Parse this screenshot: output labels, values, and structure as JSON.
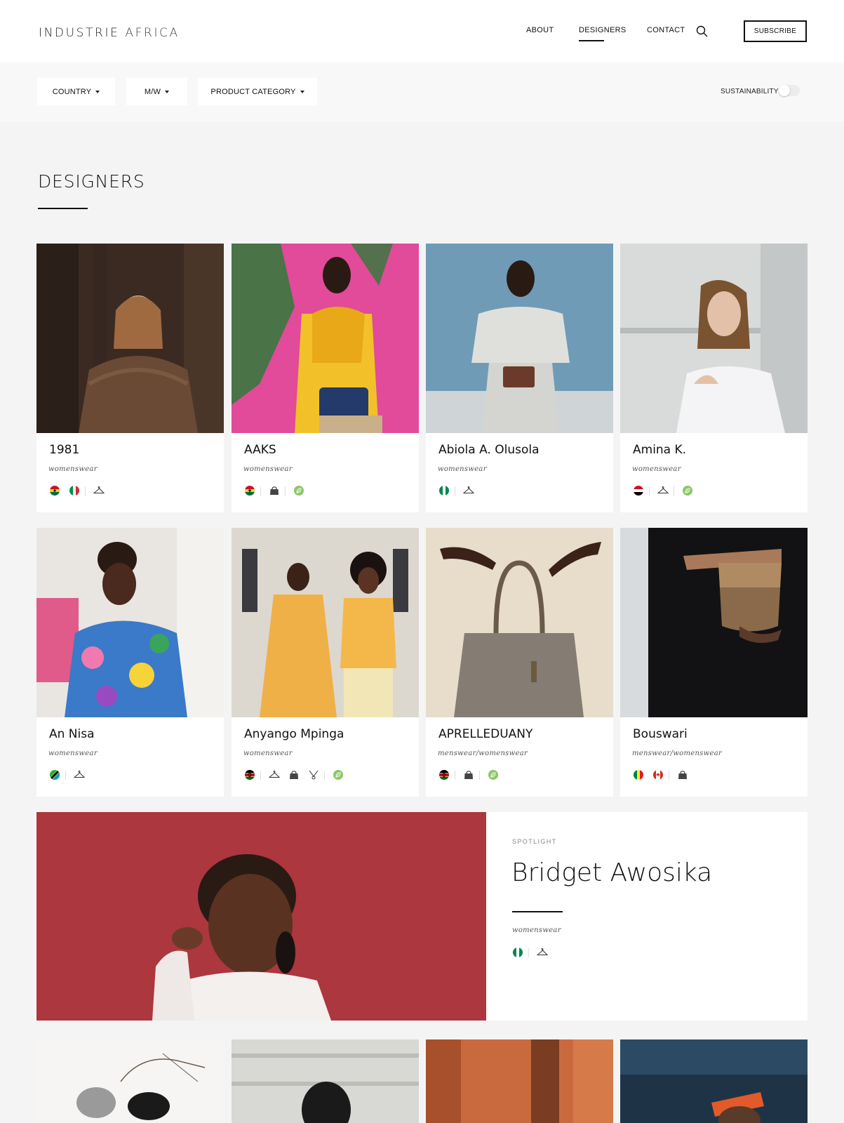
{
  "header": {
    "logo_part1": "INDUSTRIE",
    "logo_part2": "AFRICA",
    "nav": [
      {
        "label": "ABOUT"
      },
      {
        "label": "DESIGNERS",
        "active": true
      },
      {
        "label": "CONTACT"
      }
    ],
    "subscribe_label": "SUBSCRIBE"
  },
  "filters": {
    "country": "COUNTRY",
    "mw": "M/W",
    "product_category": "PRODUCT CATEGORY",
    "sustainability_label": "SUSTAINABILITY",
    "sustainability_on": false
  },
  "page_title": "DESIGNERS",
  "designers": [
    {
      "name": "1981",
      "category": "womenswear",
      "icons": [
        "flag-ghana",
        "flag-italy",
        "sep",
        "hanger"
      ]
    },
    {
      "name": "AAKS",
      "category": "womenswear",
      "icons": [
        "flag-ghana",
        "sep",
        "bag",
        "sep",
        "leaf"
      ]
    },
    {
      "name": "Abiola A. Olusola",
      "category": "womenswear",
      "icons": [
        "flag-nigeria",
        "sep",
        "hanger"
      ]
    },
    {
      "name": "Amina K.",
      "category": "womenswear",
      "icons": [
        "flag-egypt",
        "sep",
        "hanger",
        "sep",
        "leaf"
      ]
    },
    {
      "name": "An Nisa",
      "category": "womenswear",
      "icons": [
        "flag-tanzania",
        "sep",
        "hanger"
      ]
    },
    {
      "name": "Anyango Mpinga",
      "category": "womenswear",
      "icons": [
        "flag-kenya",
        "sep",
        "hanger",
        "bag",
        "jewelry",
        "sep",
        "leaf"
      ]
    },
    {
      "name": "APRELLEDUANY",
      "category": "menswear/womenswear",
      "icons": [
        "flag-kenya",
        "sep",
        "bag",
        "sep",
        "leaf"
      ]
    },
    {
      "name": "Bouswari",
      "category": "menswear/womenswear",
      "icons": [
        "flag-senegal",
        "flag-canada",
        "sep",
        "bag"
      ]
    }
  ],
  "spotlight": {
    "kicker": "SPOTLIGHT",
    "name": "Bridget Awosika",
    "category": "womenswear",
    "icons": [
      "flag-nigeria",
      "sep",
      "hanger"
    ]
  },
  "colors": {
    "leaf": "#8cc768",
    "spotlight_bg": "#a8353b",
    "page_bg": "#f4f4f4"
  }
}
